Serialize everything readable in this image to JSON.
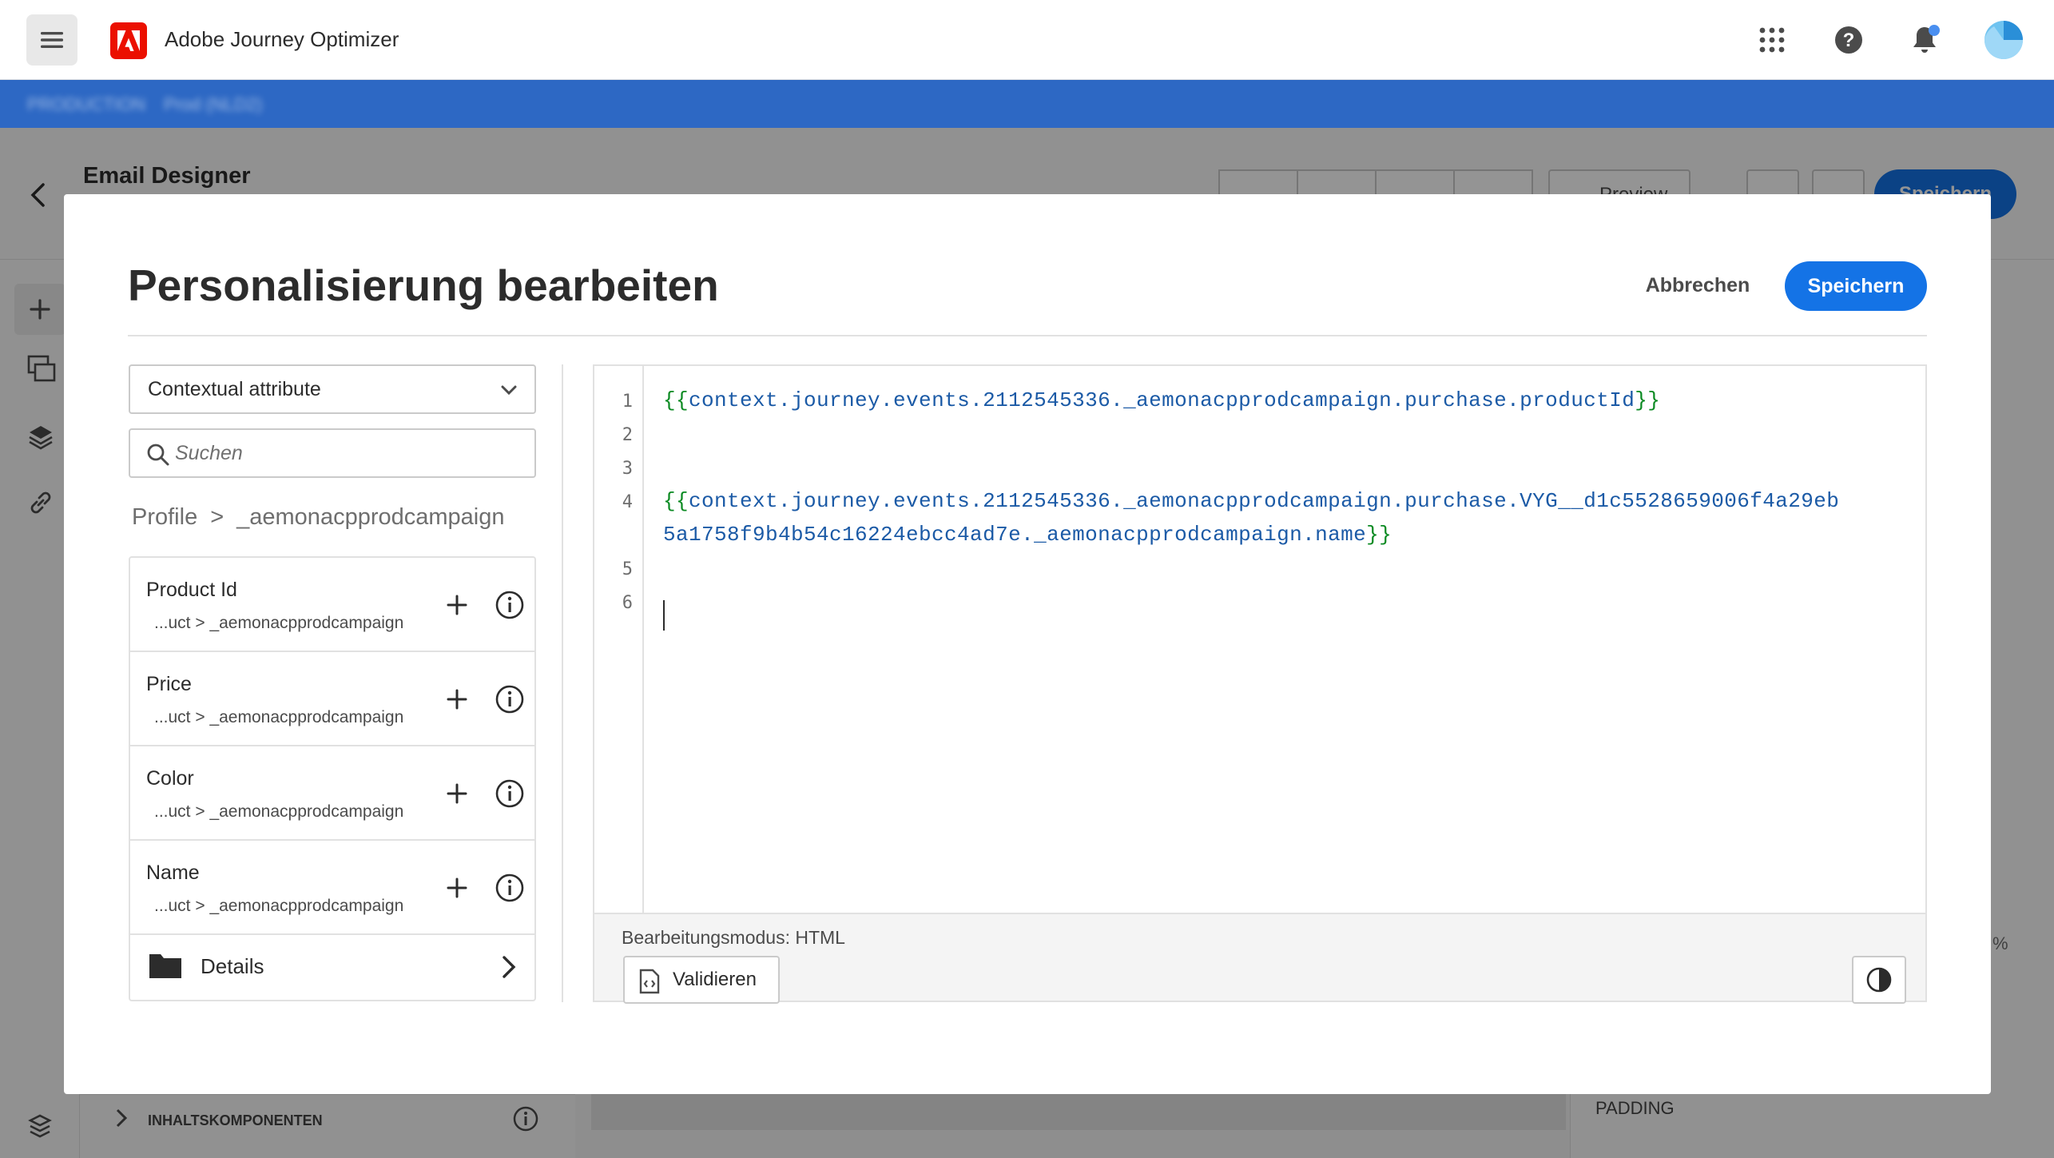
{
  "app": {
    "title": "Adobe Journey Optimizer",
    "environment": "PRODUCTION",
    "sandbox": "Prod (NLD2)"
  },
  "background": {
    "page_title": "Email Designer",
    "save_label": "Speichern",
    "preview_label": "Preview",
    "components_label": "INHALTSKOMPONENTEN",
    "padding_label": "PADDING",
    "percent": "%"
  },
  "modal": {
    "title": "Personalisierung bearbeiten",
    "cancel_label": "Abbrechen",
    "save_label": "Speichern",
    "category_select": "Contextual attribute",
    "search_placeholder": "Suchen",
    "breadcrumb": {
      "root": "Profile",
      "separator": ">",
      "current": "_aemonacpprodcampaign"
    },
    "attributes": [
      {
        "name": "Product Id",
        "path": "...uct > _aemonacpprodcampaign"
      },
      {
        "name": "Price",
        "path": "...uct > _aemonacpprodcampaign"
      },
      {
        "name": "Color",
        "path": "...uct > _aemonacpprodcampaign"
      },
      {
        "name": "Name",
        "path": "...uct > _aemonacpprodcampaign"
      }
    ],
    "details_label": "Details",
    "editor": {
      "line_numbers": [
        "1",
        "2",
        "3",
        "4",
        "5",
        "6"
      ],
      "line1_open": "{{",
      "line1_body": "context.journey.events.2112545336._aemonacpprodcampaign.purchase.productId",
      "line1_close": "}}",
      "line4_open": "{{",
      "line4_body": "context.journey.events.2112545336._aemonacpprodcampaign.purchase.VYG__d1c5528659006f4a29eb",
      "line4_cont": "5a1758f9b4b54c16224ebcc4ad7e._aemonacpprodcampaign.name",
      "line4_close": "}}",
      "mode_label": "Bearbeitungsmodus: HTML",
      "validate_label": "Validieren"
    }
  },
  "colors": {
    "accent": "#1473e6",
    "env_bar": "#2d68c4",
    "adobe_red": "#eb1000",
    "code_blue": "#1b5aa6",
    "code_green": "#0a8a22"
  }
}
